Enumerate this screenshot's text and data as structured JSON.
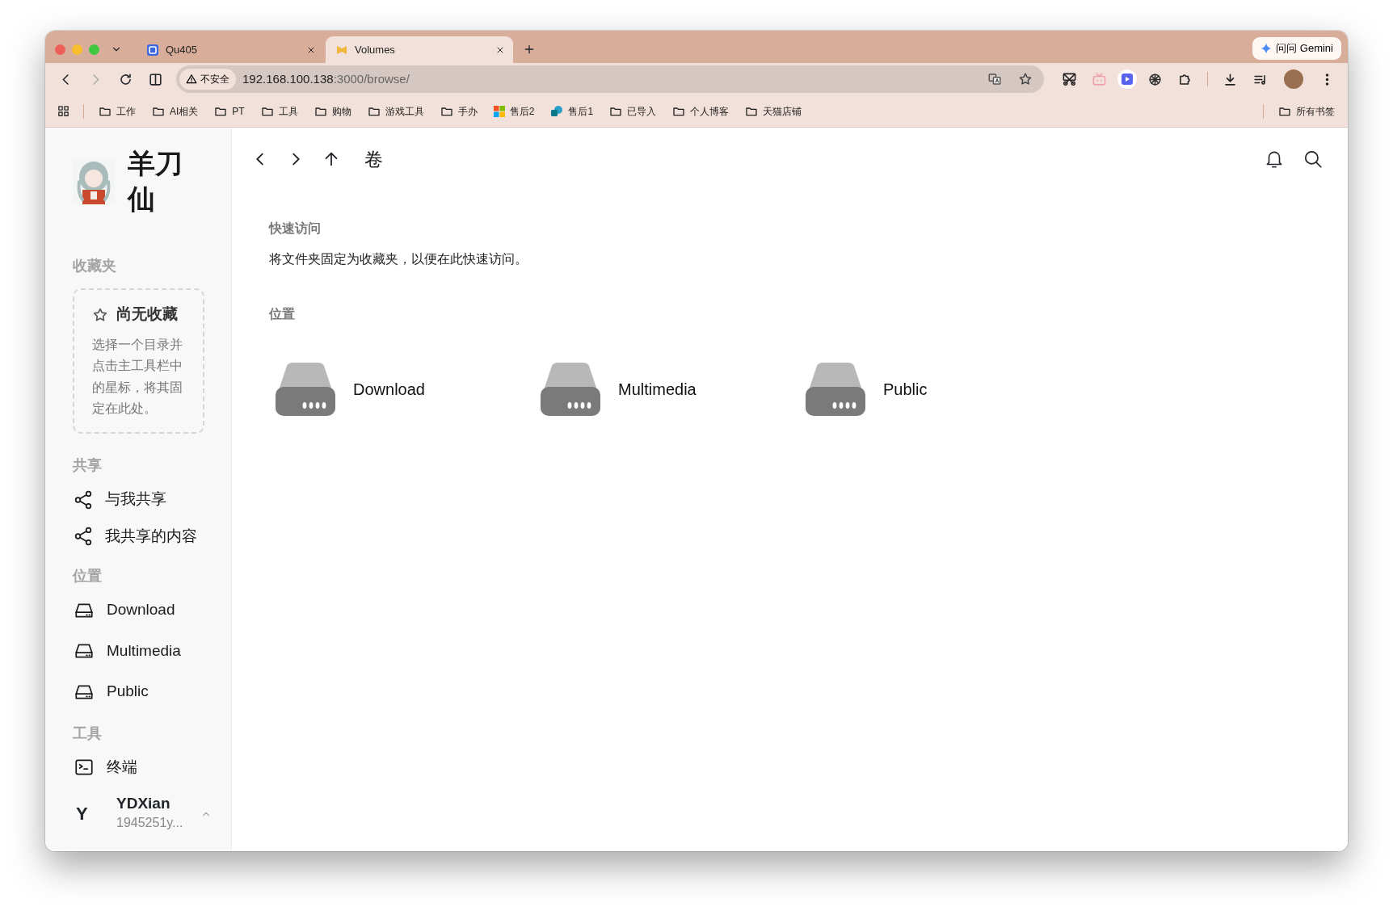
{
  "browser": {
    "tabs": [
      {
        "title": "Qu405",
        "selected": false,
        "kind": "app"
      },
      {
        "title": "Volumes",
        "selected": true,
        "kind": "volumes"
      }
    ],
    "gemini_button": "问问 Gemini",
    "security_chip": "不安全",
    "url": {
      "host": "192.168.100.138",
      "path": ":3000/browse/"
    },
    "bookmarks": [
      {
        "label": "工作",
        "kind": "folder"
      },
      {
        "label": "AI相关",
        "kind": "folder"
      },
      {
        "label": "PT",
        "kind": "folder"
      },
      {
        "label": "工具",
        "kind": "folder"
      },
      {
        "label": "购物",
        "kind": "folder"
      },
      {
        "label": "游戏工具",
        "kind": "folder"
      },
      {
        "label": "手办",
        "kind": "folder"
      },
      {
        "label": "售后2",
        "kind": "tiles"
      },
      {
        "label": "售后1",
        "kind": "site"
      },
      {
        "label": "已导入",
        "kind": "folder"
      },
      {
        "label": "个人博客",
        "kind": "folder"
      },
      {
        "label": "天猫店铺",
        "kind": "folder"
      }
    ],
    "all_bookmarks": "所有书签"
  },
  "sidebar": {
    "brand": "羊刀仙",
    "favorites": {
      "heading": "收藏夹",
      "empty_title": "尚无收藏",
      "empty_text": "选择一个目录并点击主工具栏中的星标，将其固定在此处。"
    },
    "sections": [
      {
        "heading": "共享",
        "items": [
          {
            "label": "与我共享",
            "kind": "share"
          },
          {
            "label": "我共享的内容",
            "kind": "share"
          }
        ]
      },
      {
        "heading": "位置",
        "items": [
          {
            "label": "Download",
            "kind": "drive"
          },
          {
            "label": "Multimedia",
            "kind": "drive"
          },
          {
            "label": "Public",
            "kind": "drive"
          }
        ]
      },
      {
        "heading": "工具",
        "items": [
          {
            "label": "终端",
            "kind": "terminal"
          }
        ]
      }
    ],
    "user": {
      "initial": "Y",
      "name": "YDXian",
      "id": "1945251y..."
    }
  },
  "main": {
    "title": "卷",
    "quick_access": {
      "heading": "快速访问",
      "text": "将文件夹固定为收藏夹，以便在此快速访问。"
    },
    "locations": {
      "heading": "位置",
      "items": [
        {
          "label": "Download"
        },
        {
          "label": "Multimedia"
        },
        {
          "label": "Public"
        }
      ]
    }
  }
}
